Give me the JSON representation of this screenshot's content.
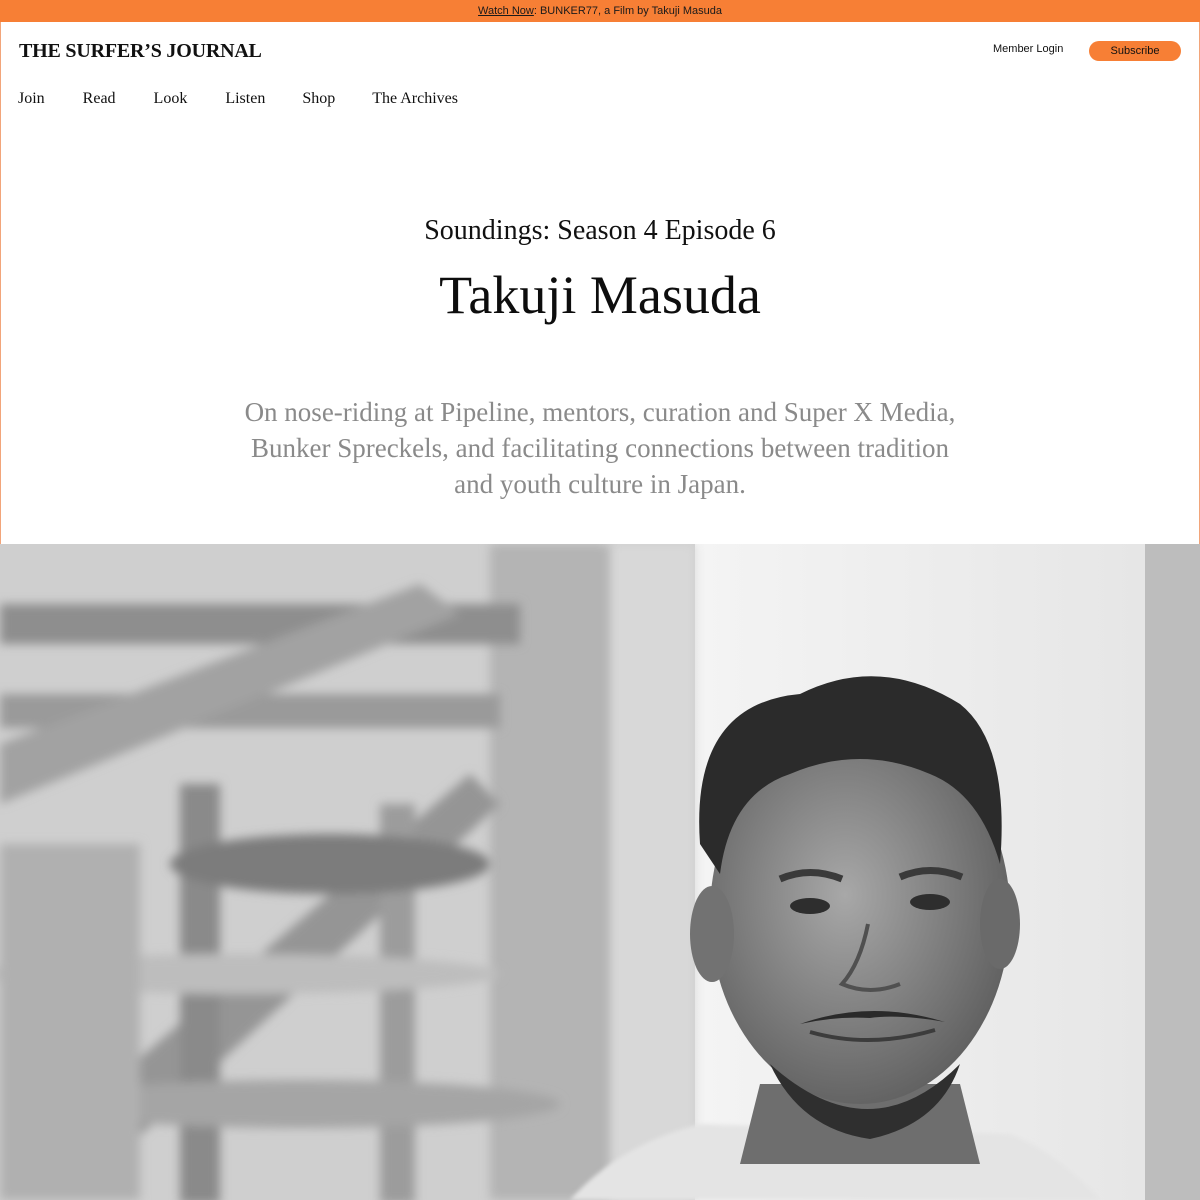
{
  "promo": {
    "link_label": "Watch Now",
    "text": ": BUNKER77, a Film by Takuji Masuda"
  },
  "header": {
    "logo": "THE SURFER’S JOURNAL",
    "member_login": "Member Login",
    "subscribe": "Subscribe"
  },
  "nav": {
    "items": [
      {
        "label": "Join"
      },
      {
        "label": "Read"
      },
      {
        "label": "Look"
      },
      {
        "label": "Listen"
      },
      {
        "label": "Shop"
      },
      {
        "label": "The Archives"
      }
    ]
  },
  "article": {
    "kicker": "Soundings: Season 4 Episode 6",
    "title": "Takuji Masuda",
    "dek": "On nose-riding at Pipeline, mentors, curation and Super X Media, Bunker Spreckels, and facilitating connections between tradition and youth culture in Japan."
  },
  "colors": {
    "accent": "#f77f35",
    "text": "#111111",
    "dek": "#8a8a8a"
  }
}
